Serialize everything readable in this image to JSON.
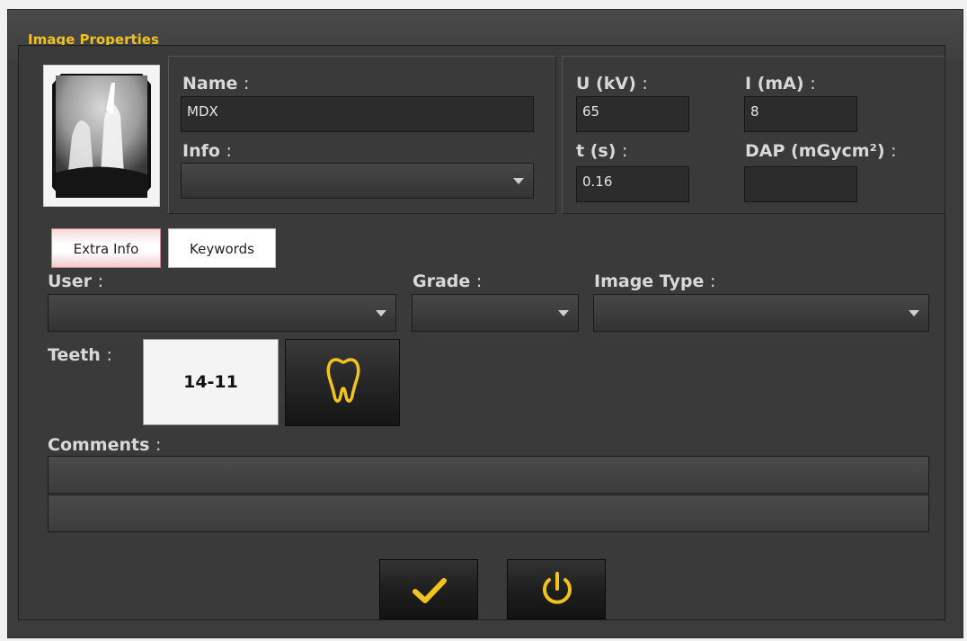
{
  "window": {
    "title": "Image Properties"
  },
  "image": {
    "thumbnail": "dental-xray-thumbnail"
  },
  "fields": {
    "name": {
      "label": "Name",
      "value": "MDX"
    },
    "info": {
      "label": "Info",
      "value": ""
    },
    "voltage": {
      "label": "U (kV)",
      "value": "65"
    },
    "current": {
      "label": "I (mA)",
      "value": "8"
    },
    "time": {
      "label": "t (s)",
      "value": "0.16"
    },
    "dap": {
      "label": "DAP (mGycm²)",
      "value": ""
    }
  },
  "tabs": [
    {
      "label": "Extra Info",
      "active": true
    },
    {
      "label": "Keywords",
      "active": false
    }
  ],
  "extra": {
    "user": {
      "label": "User",
      "value": ""
    },
    "grade": {
      "label": "Grade",
      "value": ""
    },
    "image_type": {
      "label": "Image Type",
      "value": ""
    },
    "teeth": {
      "label": "Teeth",
      "value": "14-11"
    },
    "comments": {
      "label": "Comments",
      "lines": [
        "",
        ""
      ]
    }
  },
  "colon": ":",
  "icons": {
    "tooth": "tooth-icon",
    "ok": "checkmark-icon",
    "power": "power-icon"
  },
  "colors": {
    "accent": "#f0c020",
    "background": "#3c3c3c"
  }
}
